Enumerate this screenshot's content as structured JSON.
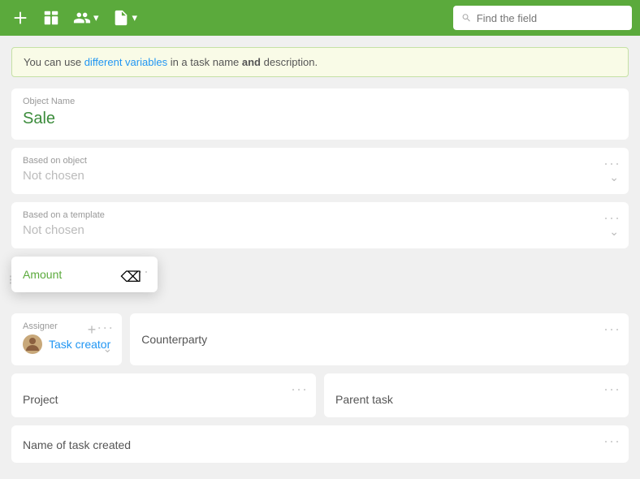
{
  "toolbar": {
    "search_placeholder": "Find the field",
    "icons": [
      "add-icon",
      "layout-icon",
      "users-icon",
      "document-icon"
    ]
  },
  "banner": {
    "prefix": "You can use ",
    "link1": "different variables",
    "middle": " in a task name",
    "conjunction": " and",
    "suffix": " description."
  },
  "object_name": {
    "label": "Object Name",
    "value": "Sale"
  },
  "based_on_object": {
    "label": "Based on object",
    "value": "Not chosen"
  },
  "based_on_template": {
    "label": "Based on a template",
    "value": "Not chosen"
  },
  "amount": {
    "label": "Amount",
    "dots": "···"
  },
  "assigner": {
    "label": "Assigner",
    "value": "Task creator",
    "dots": "···",
    "plus": "+"
  },
  "counterparty": {
    "label": "Counterparty",
    "dots": "···"
  },
  "project": {
    "label": "Project",
    "dots": "···"
  },
  "parent_task": {
    "label": "Parent task",
    "dots": "···"
  },
  "name_of_task": {
    "label": "Name of task created",
    "dots": "···"
  }
}
